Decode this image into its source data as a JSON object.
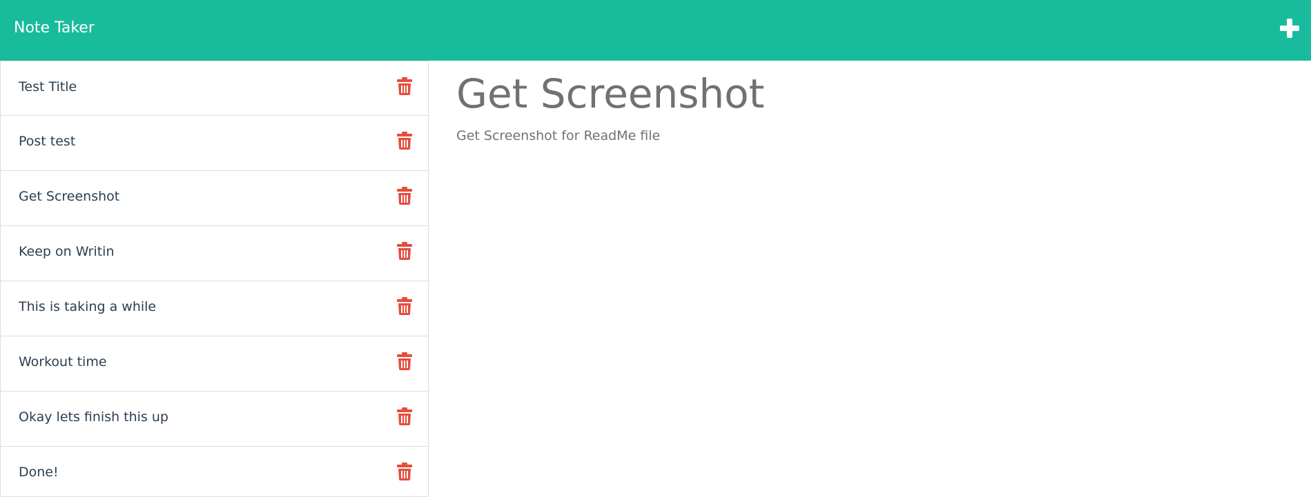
{
  "app": {
    "title": "Note Taker",
    "accent_color": "#18bc9c",
    "danger_color": "#e74c3c",
    "new_note_icon": "plus-icon",
    "delete_icon": "trash-icon"
  },
  "notes": [
    {
      "title": "Test Title"
    },
    {
      "title": "Post test"
    },
    {
      "title": "Get Screenshot"
    },
    {
      "title": "Keep on Writin"
    },
    {
      "title": "This is taking a while"
    },
    {
      "title": "Workout time"
    },
    {
      "title": "Okay lets finish this up"
    },
    {
      "title": "Done!"
    }
  ],
  "active_note": {
    "title": "Get Screenshot",
    "text": "Get Screenshot for ReadMe file"
  }
}
